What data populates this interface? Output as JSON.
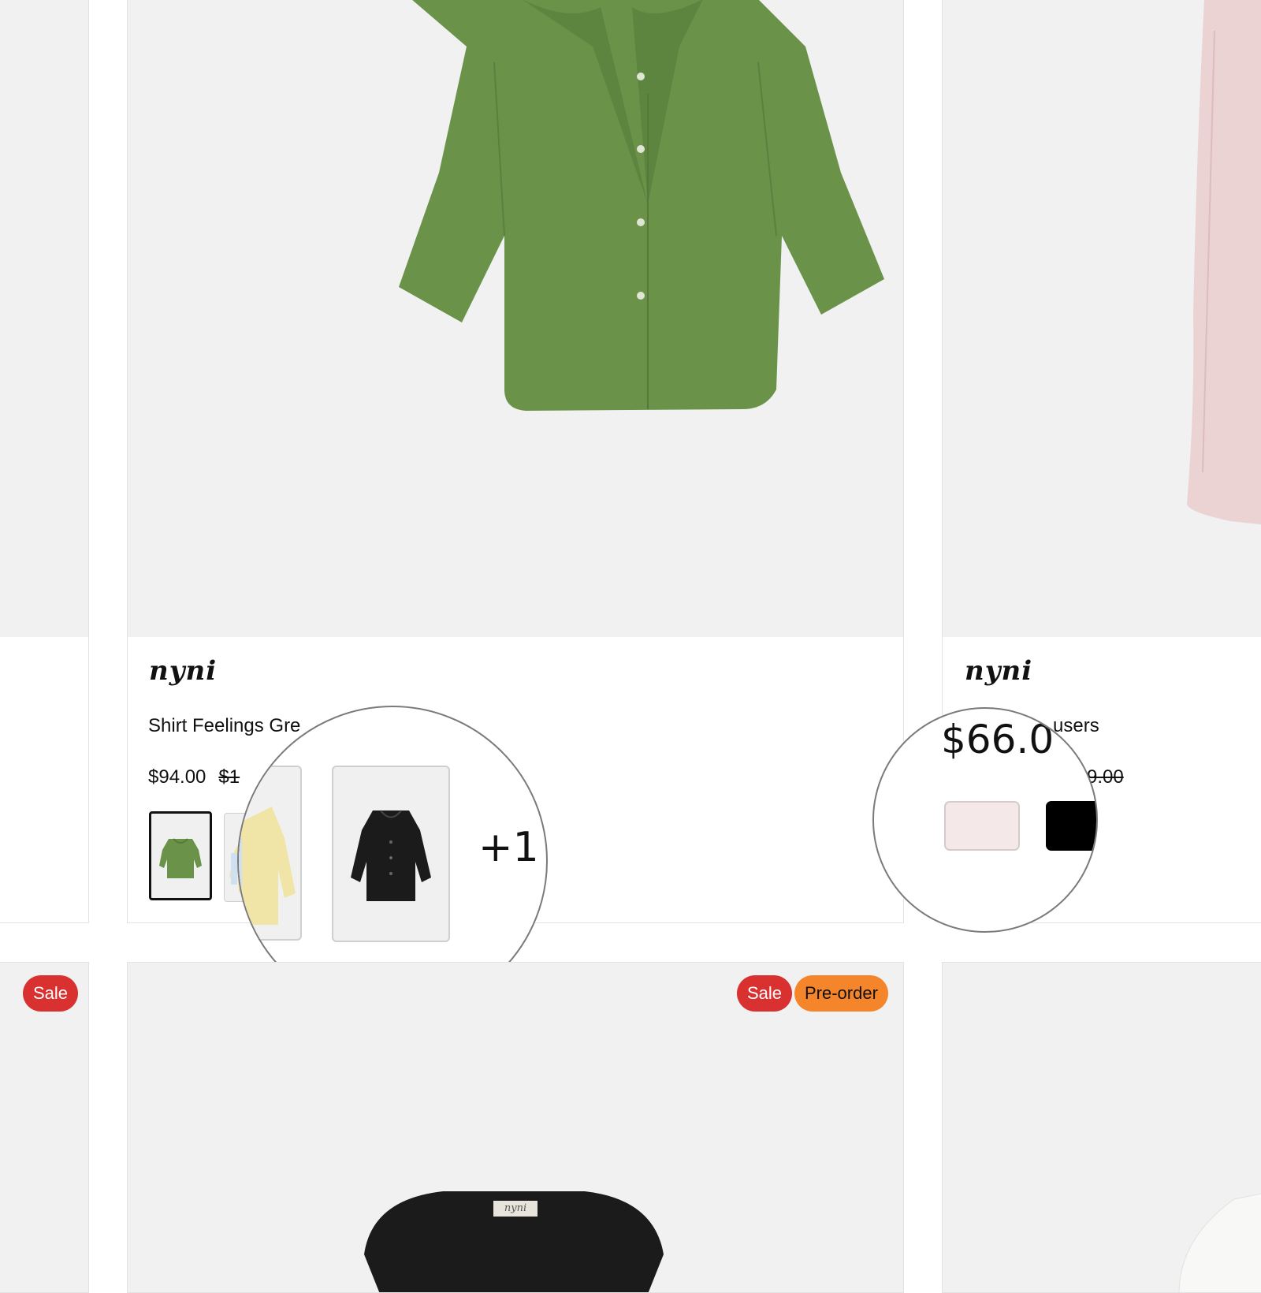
{
  "colors": {
    "sale_badge": "#d93030",
    "preorder_badge": "#f5852b",
    "shirt_green": "#6a9248",
    "image_bg": "#f1f1f1",
    "swatch_pink": "#f5e8e9",
    "swatch_black": "#000000"
  },
  "top_row": {
    "center_card": {
      "brand": "nyni",
      "title": "Shirt Feelings Gre",
      "price": "$94.00",
      "compare_price": "$1",
      "color_thumbs": [
        "green-shirt-thumb",
        "yellow-shirt-thumb",
        "black-shirt-thumb"
      ],
      "more_count": "+1"
    },
    "right_card": {
      "brand": "nyni",
      "title_fragment": "users",
      "price_zoomed": "$66.0",
      "compare_price_fragment": "9.00",
      "swatches": [
        "pink",
        "black"
      ]
    }
  },
  "bottom_row": {
    "left_card": {
      "badges": [
        "Sale"
      ]
    },
    "center_card": {
      "badges": [
        "Sale",
        "Pre-order"
      ],
      "label_tag": "nyni"
    }
  }
}
